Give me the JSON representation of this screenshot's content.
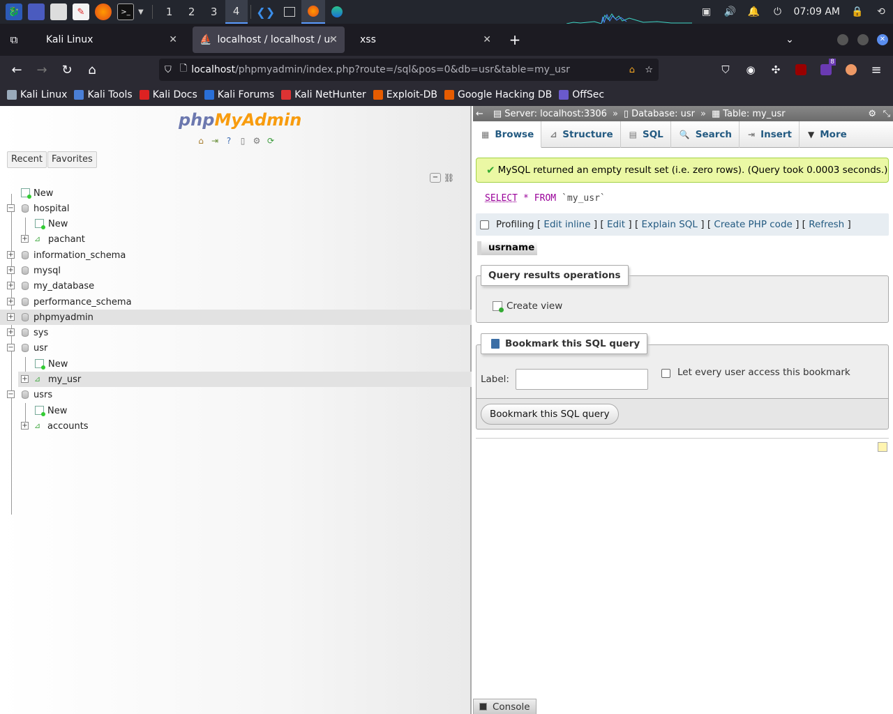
{
  "taskbar": {
    "workspaces": [
      "1",
      "2",
      "3",
      "4"
    ],
    "active_workspace": "4",
    "clock": "07:09 AM"
  },
  "browser": {
    "tabs": [
      {
        "label": "Kali Linux"
      },
      {
        "label": "localhost / localhost / usr"
      },
      {
        "label": "xss"
      }
    ],
    "url_host": "localhost",
    "url_rest": "/phpmyadmin/index.php?route=/sql&pos=0&db=usr&table=my_usr",
    "extension_badge": "8",
    "bookmarks": [
      {
        "label": "Kali Linux",
        "color": "#9ab"
      },
      {
        "label": "Kali Tools",
        "color": "#4a7fd6"
      },
      {
        "label": "Kali Docs",
        "color": "#d22"
      },
      {
        "label": "Kali Forums",
        "color": "#2a6fd6"
      },
      {
        "label": "Kali NetHunter",
        "color": "#d33"
      },
      {
        "label": "Exploit-DB",
        "color": "#e65c00"
      },
      {
        "label": "Google Hacking DB",
        "color": "#e65c00"
      },
      {
        "label": "OffSec",
        "color": "#6a5acd"
      }
    ]
  },
  "sidebar": {
    "logo_php": "php",
    "logo_myadmin": "MyAdmin",
    "recent_label": "Recent",
    "favorites_label": "Favorites",
    "tree": {
      "new_root": "New",
      "hospital": "hospital",
      "hospital_new": "New",
      "pachant": "pachant",
      "information_schema": "information_schema",
      "mysql": "mysql",
      "my_database": "my_database",
      "performance_schema": "performance_schema",
      "phpmyadmin": "phpmyadmin",
      "sys": "sys",
      "usr": "usr",
      "usr_new": "New",
      "my_usr": "my_usr",
      "usrs": "usrs",
      "usrs_new": "New",
      "accounts": "accounts"
    }
  },
  "main": {
    "breadcrumb": {
      "server": "Server: localhost:3306",
      "database": "Database: usr",
      "table": "Table: my_usr"
    },
    "tabs": {
      "browse": "Browse",
      "structure": "Structure",
      "sql": "SQL",
      "search": "Search",
      "insert": "Insert",
      "more": "More"
    },
    "success_message": "MySQL returned an empty result set (i.e. zero rows). (Query took 0.0003 seconds.)",
    "sql": {
      "select": "SELECT",
      "star": "*",
      "from": "FROM",
      "table": "`my_usr`"
    },
    "profiling": {
      "label": "Profiling",
      "edit_inline": "Edit inline",
      "edit": "Edit",
      "explain": "Explain SQL",
      "create_php": "Create PHP code",
      "refresh": "Refresh"
    },
    "column_header": "usrname",
    "qro": {
      "legend": "Query results operations",
      "create_view": "Create view"
    },
    "bookmark": {
      "legend": "Bookmark this SQL query",
      "label_text": "Label:",
      "label_value": "",
      "share_label": "Let every user access this bookmark",
      "submit": "Bookmark this SQL query"
    },
    "console_label": "Console"
  }
}
